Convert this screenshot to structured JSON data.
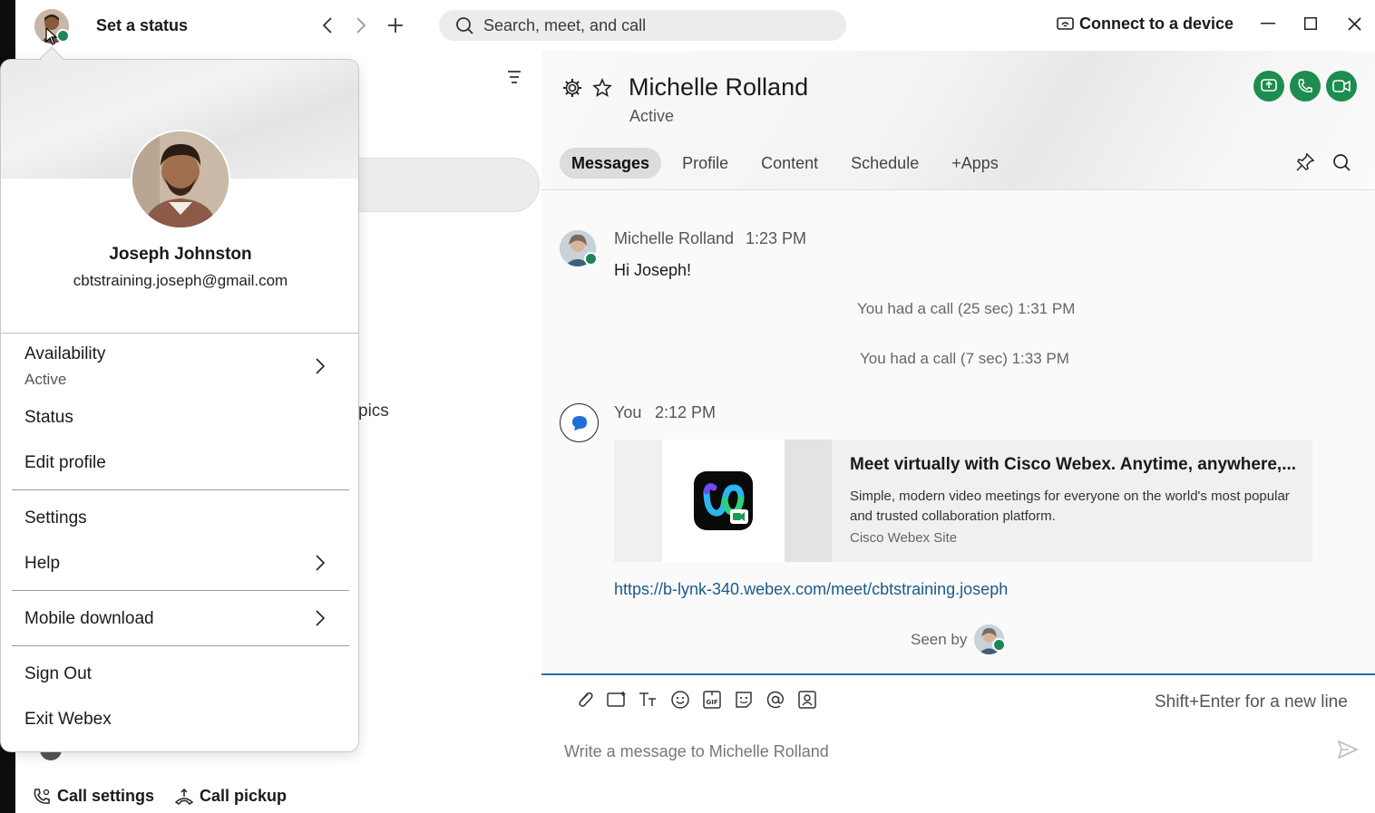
{
  "titlebar": {
    "set_status_label": "Set a status",
    "search_placeholder": "Search, meet, and call",
    "connect_label": "Connect to a device"
  },
  "sidebar": {
    "partial_text": "pics",
    "call_settings_label": "Call settings",
    "call_pickup_label": "Call pickup"
  },
  "profile_menu": {
    "name": "Joseph Johnston",
    "email": "cbtstraining.joseph@gmail.com",
    "availability_label": "Availability",
    "availability_value": "Active",
    "status_label": "Status",
    "edit_profile_label": "Edit profile",
    "settings_label": "Settings",
    "help_label": "Help",
    "mobile_download_label": "Mobile download",
    "sign_out_label": "Sign Out",
    "exit_label": "Exit Webex"
  },
  "chat": {
    "contact_name": "Michelle Rolland",
    "contact_status": "Active",
    "tabs": [
      {
        "label": "Messages"
      },
      {
        "label": "Profile"
      },
      {
        "label": "Content"
      },
      {
        "label": "Schedule"
      },
      {
        "label": "+Apps"
      }
    ],
    "messages": [
      {
        "sender": "Michelle Rolland",
        "time": "1:23 PM",
        "text": "Hi Joseph!"
      }
    ],
    "system_events": [
      "You had a call (25 sec) 1:31 PM",
      "You had a call (7 sec) 1:33 PM"
    ],
    "own_message": {
      "sender": "You",
      "time": "2:12 PM",
      "card_title": "Meet virtually with Cisco Webex. Anytime, anywhere,...",
      "card_description": "Simple, modern video meetings for everyone on the world's most popular and trusted collaboration platform.",
      "card_site": "Cisco Webex Site",
      "link": "https://b-lynk-340.webex.com/meet/cbtstraining.joseph"
    },
    "seen_by_label": "Seen by",
    "composer": {
      "hint": "Shift+Enter for a new line",
      "placeholder": "Write a message to Michelle Rolland"
    }
  },
  "colors": {
    "presence_green": "#1a8754",
    "call_button_green": "#1d8d4f",
    "link_blue": "#1a5a8a",
    "composer_accent": "#1e6fa8"
  }
}
